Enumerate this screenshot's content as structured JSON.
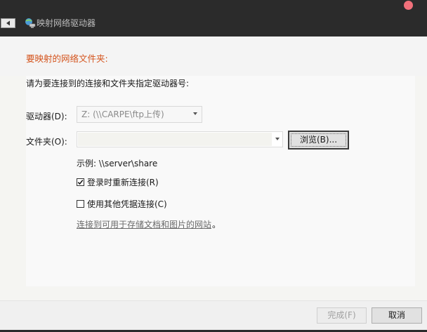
{
  "window": {
    "title": "映射网络驱动器",
    "colors": {
      "titlebar": "#2b2b2b",
      "instruction": "#d4541d",
      "close": "#f1707a"
    }
  },
  "header": {
    "instruction": "要映射的网络文件夹:"
  },
  "main": {
    "description": "请为要连接到的连接和文件夹指定驱动器号:",
    "drive_label": "驱动器(D):",
    "drive_value": "Z: (\\\\CARPE\\ftp上传)",
    "folder_label": "文件夹(O):",
    "folder_value": "",
    "browse_label": "浏览(B)...",
    "example": "示例: \\\\server\\share",
    "reconnect_label": "登录时重新连接(R)",
    "reconnect_checked": true,
    "other_cred_label": "使用其他凭据连接(C)",
    "other_cred_checked": false,
    "link_text": "连接到可用于存储文档和图片的网站",
    "link_period": "。"
  },
  "footer": {
    "finish_label": "完成(F)",
    "cancel_label": "取消"
  }
}
